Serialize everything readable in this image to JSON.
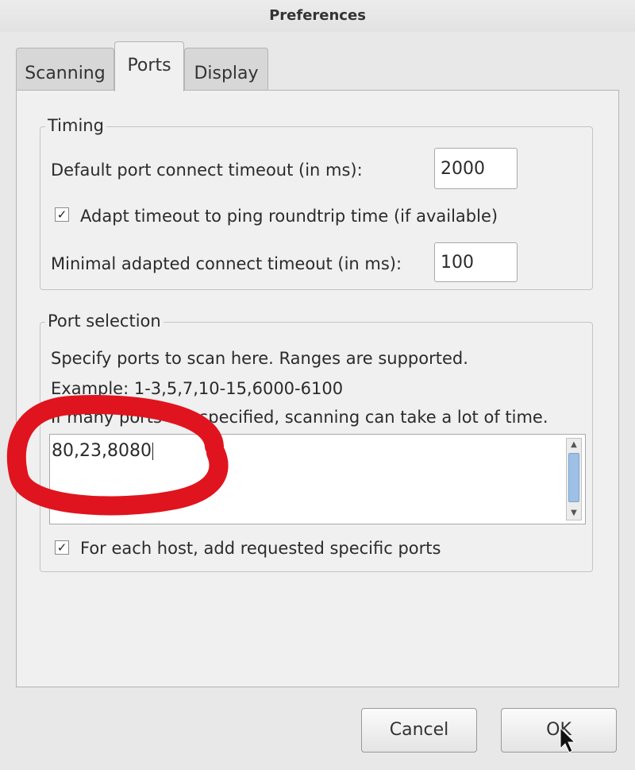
{
  "window": {
    "title": "Preferences"
  },
  "tabs": [
    {
      "label": "Scanning",
      "active": false
    },
    {
      "label": "Ports",
      "active": true
    },
    {
      "label": "Display",
      "active": false
    }
  ],
  "timing": {
    "legend": "Timing",
    "default_timeout_label": "Default port connect timeout (in ms):",
    "default_timeout_value": "2000",
    "adapt_checkbox_label": "Adapt timeout to ping roundtrip time (if available)",
    "adapt_checked": true,
    "min_timeout_label": "Minimal adapted connect timeout (in ms):",
    "min_timeout_value": "100"
  },
  "port_selection": {
    "legend": "Port selection",
    "hint_line1": "Specify ports to scan here. Ranges are supported.",
    "hint_line2": "Example: 1-3,5,7,10-15,6000-6100",
    "hint_line3": "If many ports are specified, scanning can take a lot of time.",
    "ports_value": "80,23,8080",
    "add_specific_label": "For each host, add requested specific ports",
    "add_specific_checked": true
  },
  "buttons": {
    "cancel": "Cancel",
    "ok": "OK"
  },
  "colors": {
    "annotation": "#e0141e",
    "scroll_thumb": "#9ec0e6"
  }
}
